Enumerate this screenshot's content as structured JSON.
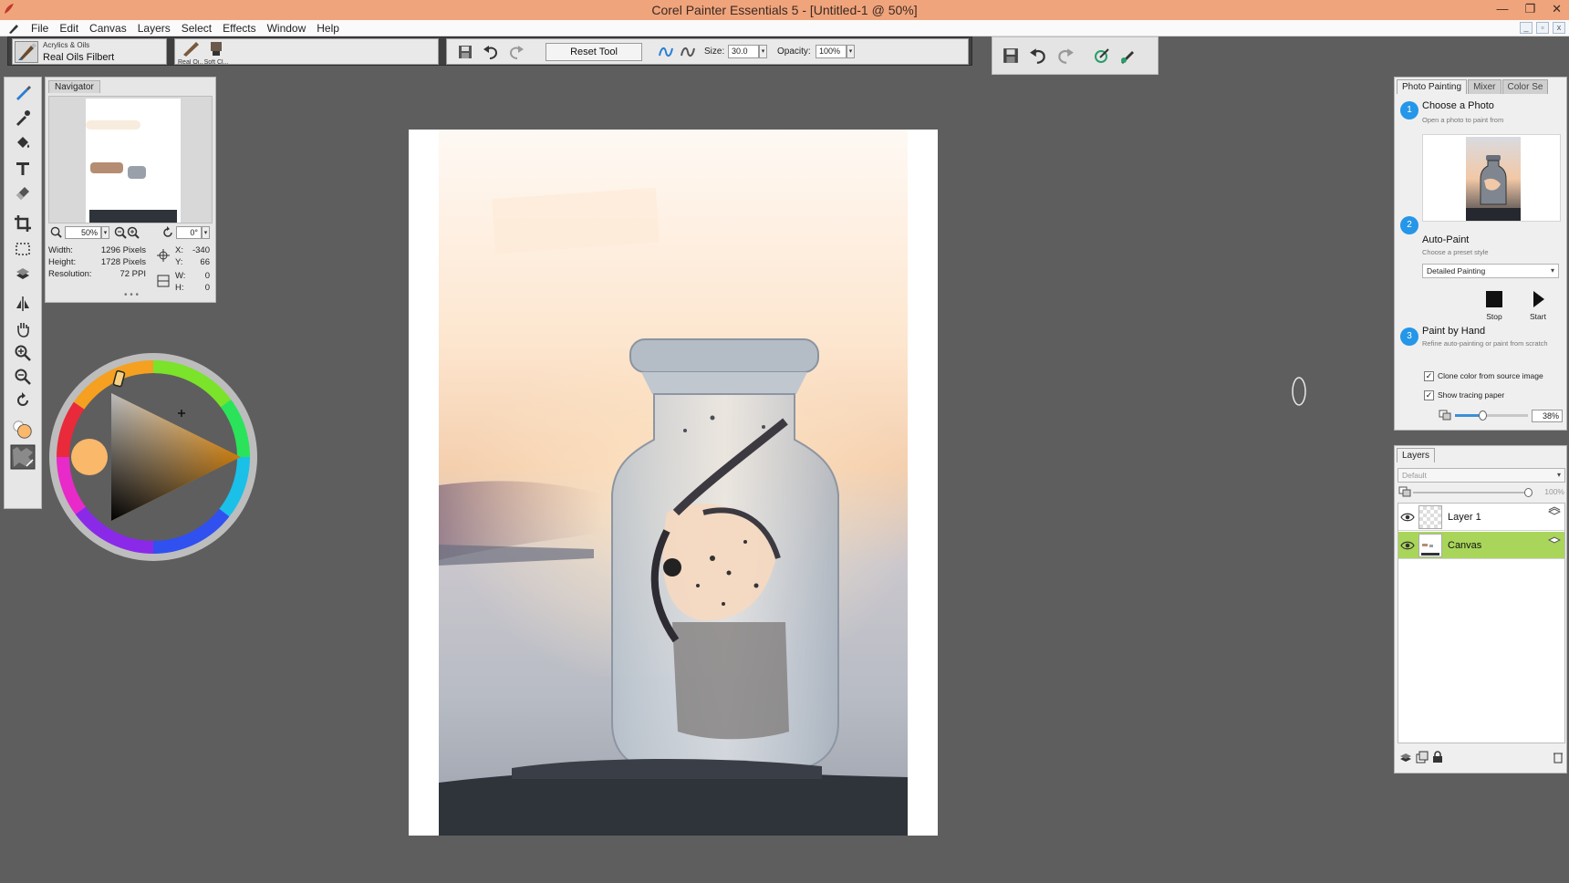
{
  "window": {
    "title": "Corel Painter Essentials 5 - [Untitled-1 @ 50%]"
  },
  "menu": [
    "File",
    "Edit",
    "Canvas",
    "Layers",
    "Select",
    "Effects",
    "Window",
    "Help"
  ],
  "brush_selector": {
    "category": "Acrylics & Oils",
    "variant": "Real Oils Filbert"
  },
  "recent_brushes": [
    {
      "label": "Real Oi..."
    },
    {
      "label": "Soft Cl..."
    }
  ],
  "property_bar": {
    "reset_label": "Reset Tool",
    "size_label": "Size:",
    "size_value": "30.0",
    "opacity_label": "Opacity:",
    "opacity_value": "100%"
  },
  "navigator": {
    "tab": "Navigator",
    "zoom_value": "50%",
    "rotation_value": "0°",
    "width_label": "Width:",
    "width_value": "1296 Pixels",
    "height_label": "Height:",
    "height_value": "1728 Pixels",
    "resolution_label": "Resolution:",
    "resolution_value": "72 PPI",
    "x_label": "X:",
    "x_value": "-340",
    "y_label": "Y:",
    "y_value": "66",
    "w_label": "W:",
    "w_value": "0",
    "h_label": "H:",
    "h_value": "0"
  },
  "color": {
    "main_color": "#f9b86a"
  },
  "photo_panel": {
    "tabs": [
      "Photo Painting",
      "Mixer",
      "Color Se"
    ],
    "step1_num": "1",
    "step1_title": "Choose a Photo",
    "step1_sub": "Open a photo to paint from",
    "step2_num": "2",
    "step2_title": "Auto-Paint",
    "step2_sub": "Choose a preset style",
    "style_value": "Detailed Painting",
    "stop_label": "Stop",
    "start_label": "Start",
    "step3_num": "3",
    "step3_title": "Paint by Hand",
    "step3_sub": "Refine auto-painting or paint from scratch",
    "clone_label": "Clone color from source image",
    "clone_checked": "✓",
    "tracing_label": "Show tracing paper",
    "tracing_checked": "✓",
    "tracing_value": "38%",
    "tracing_fraction": 0.38
  },
  "layers_panel": {
    "tab": "Layers",
    "composite": "Default",
    "opacity_value": "100%",
    "opacity_fraction": 1.0,
    "layers": [
      {
        "name": "Layer 1",
        "selected": false
      },
      {
        "name": "Canvas",
        "selected": true
      }
    ]
  }
}
